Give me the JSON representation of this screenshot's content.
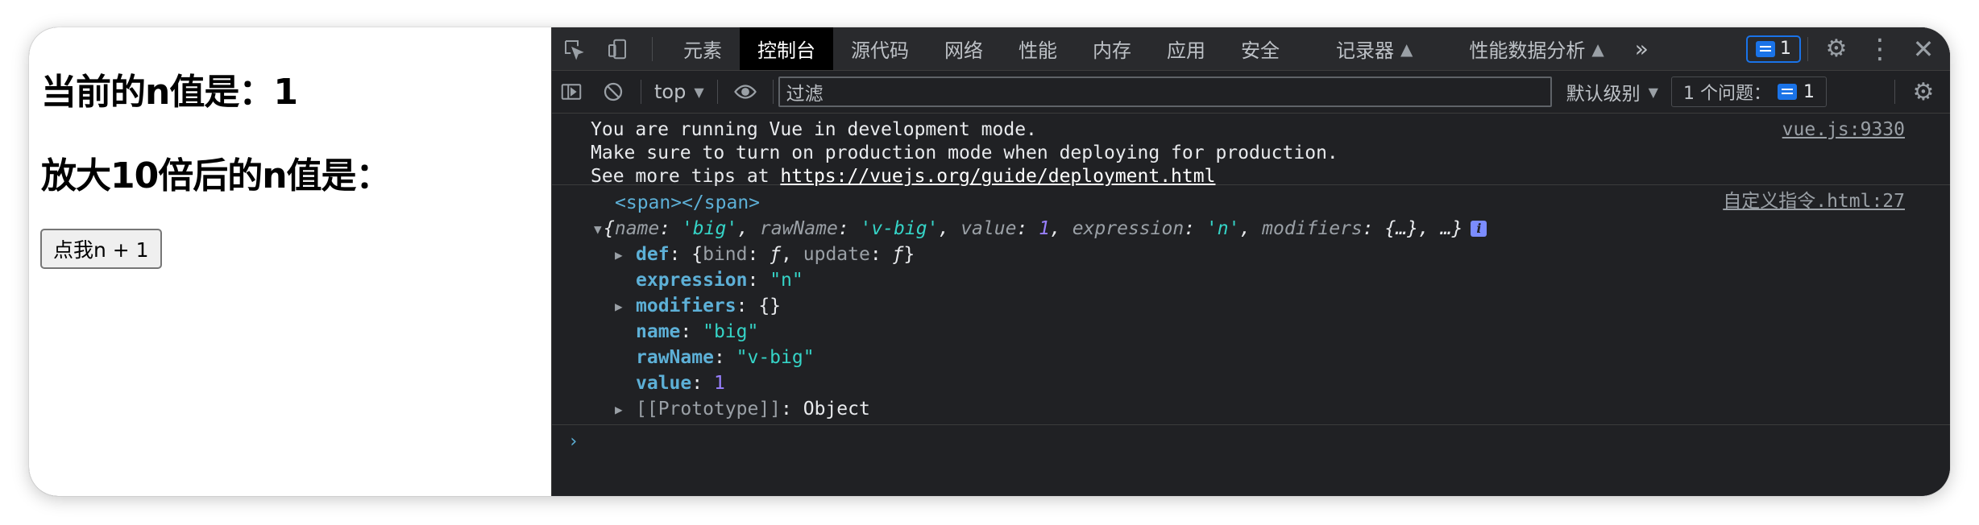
{
  "page": {
    "heading_n": "当前的n值是：1",
    "heading_big": "放大10倍后的n值是：",
    "button_label": "点我n + 1"
  },
  "devtools": {
    "tabs": [
      {
        "label": "元素",
        "active": false
      },
      {
        "label": "控制台",
        "active": true
      },
      {
        "label": "源代码",
        "active": false
      },
      {
        "label": "网络",
        "active": false
      },
      {
        "label": "性能",
        "active": false
      },
      {
        "label": "内存",
        "active": false
      },
      {
        "label": "应用",
        "active": false
      },
      {
        "label": "安全",
        "active": false
      },
      {
        "label": "记录器",
        "active": false,
        "experimental": true
      },
      {
        "label": "性能数据分析",
        "active": false,
        "experimental": true
      }
    ],
    "more_tabs": "»",
    "issues_badge_count": "1",
    "context": "top",
    "filter_placeholder": "过滤",
    "levels": "默认级别",
    "issues_label": "1 个问题：",
    "issues_count": "1"
  },
  "console": {
    "msg1": {
      "line1": "You are running Vue in development mode.",
      "line2": "Make sure to turn on production mode when deploying for production.",
      "line3_prefix": "See more tips at ",
      "line3_url": "https://vuejs.org/guide/deployment.html",
      "source": "vue.js:9330"
    },
    "msg2": {
      "source": "自定义指令.html:27",
      "tag": "<span></span>",
      "summary": {
        "name_key": "name",
        "name_val": "'big'",
        "rawName_key": "rawName",
        "rawName_val": "'v-big'",
        "value_key": "value",
        "value_val": "1",
        "expression_key": "expression",
        "expression_val": "'n'",
        "modifiers_key": "modifiers",
        "modifiers_val": "{…}",
        "ellipsis": "…"
      },
      "props": {
        "def_key": "def",
        "def_bind_key": "bind",
        "def_update_key": "update",
        "fn": "ƒ",
        "expression_key": "expression",
        "expression_val": "\"n\"",
        "modifiers_key": "modifiers",
        "modifiers_val": "{}",
        "name_key": "name",
        "name_val": "\"big\"",
        "rawName_key": "rawName",
        "rawName_val": "\"v-big\"",
        "value_key": "value",
        "value_val": "1",
        "proto_key": "[[Prototype]]",
        "proto_val": "Object"
      }
    },
    "prompt": "›"
  }
}
